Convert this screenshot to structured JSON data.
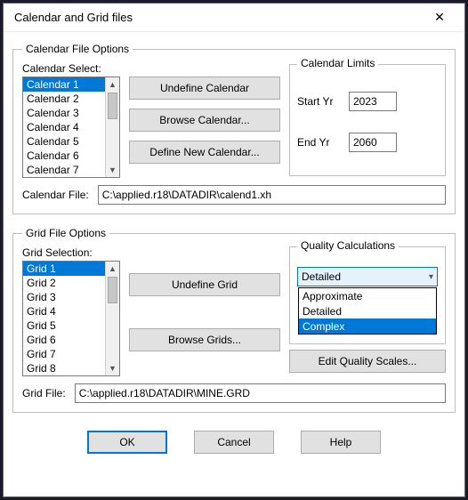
{
  "window": {
    "title": "Calendar and Grid files"
  },
  "calendar": {
    "legend": "Calendar File Options",
    "select_label": "Calendar Select:",
    "items": [
      "Calendar 1",
      "Calendar 2",
      "Calendar 3",
      "Calendar 4",
      "Calendar 5",
      "Calendar 6",
      "Calendar 7"
    ],
    "buttons": {
      "undefine": "Undefine Calendar",
      "browse": "Browse Calendar...",
      "define": "Define New Calendar..."
    },
    "limits": {
      "legend": "Calendar Limits",
      "start_label": "Start Yr",
      "start_value": "2023",
      "end_label": "End  Yr",
      "end_value": "2060"
    },
    "file_label": "Calendar File:",
    "file_value": "C:\\applied.r18\\DATADIR\\calend1.xh"
  },
  "grid": {
    "legend": "Grid File Options",
    "select_label": "Grid Selection:",
    "items": [
      "Grid 1",
      "Grid 2",
      "Grid 3",
      "Grid 4",
      "Grid 5",
      "Grid 6",
      "Grid 7",
      "Grid 8"
    ],
    "buttons": {
      "undefine": "Undefine Grid",
      "browse": "Browse Grids..."
    },
    "quality": {
      "legend": "Quality Calculations",
      "selected": "Detailed",
      "options": [
        "Approximate",
        "Detailed",
        "Complex"
      ],
      "edit_scales": "Edit Quality Scales..."
    },
    "file_label": "Grid File:",
    "file_value": "C:\\applied.r18\\DATADIR\\MINE.GRD"
  },
  "footer": {
    "ok": "OK",
    "cancel": "Cancel",
    "help": "Help"
  }
}
